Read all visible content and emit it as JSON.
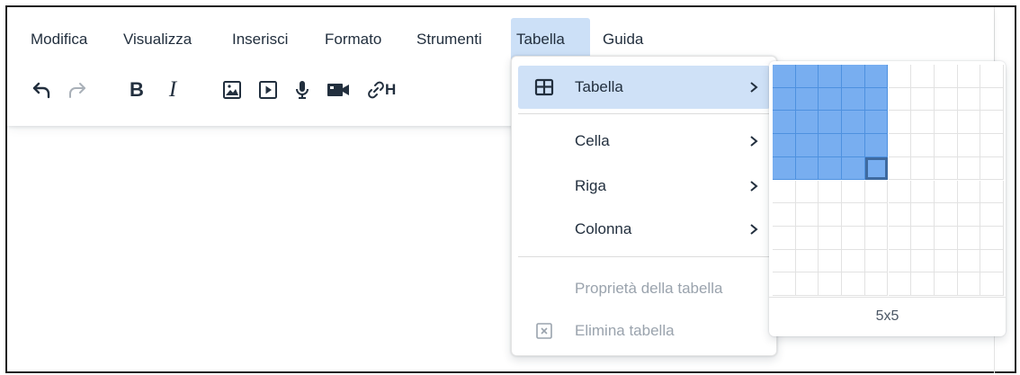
{
  "menubar": {
    "items": [
      {
        "label": "Modifica"
      },
      {
        "label": "Visualizza"
      },
      {
        "label": "Inserisci"
      },
      {
        "label": "Formato"
      },
      {
        "label": "Strumenti"
      },
      {
        "label": "Tabella",
        "active": true
      },
      {
        "label": "Guida"
      }
    ]
  },
  "toolbar": {
    "undo_icon": "undo-icon",
    "redo_icon": "redo-icon",
    "bold_label": "B",
    "italic_label": "I",
    "image_icon": "image-icon",
    "media_icon": "media-play-icon",
    "mic_icon": "microphone-icon",
    "video_icon": "video-camera-icon",
    "link_icon": "link-icon",
    "h_label": "H"
  },
  "table_menu": {
    "items": [
      {
        "label": "Tabella",
        "icon": "table-icon",
        "submenu": true,
        "highlighted": true
      },
      {
        "label": "Cella",
        "submenu": true
      },
      {
        "label": "Riga",
        "submenu": true
      },
      {
        "label": "Colonna",
        "submenu": true
      },
      {
        "label": "Proprietà della tabella",
        "disabled": true
      },
      {
        "label": "Elimina tabella",
        "icon": "delete-table-icon",
        "disabled": true
      }
    ]
  },
  "table_picker": {
    "size_label": "5x5",
    "selected_rows": 5,
    "selected_cols": 5
  },
  "colors": {
    "accent": "#cce0f7",
    "selection": "#78aef0",
    "text": "#222f3e",
    "disabled": "#9aa3ad"
  }
}
